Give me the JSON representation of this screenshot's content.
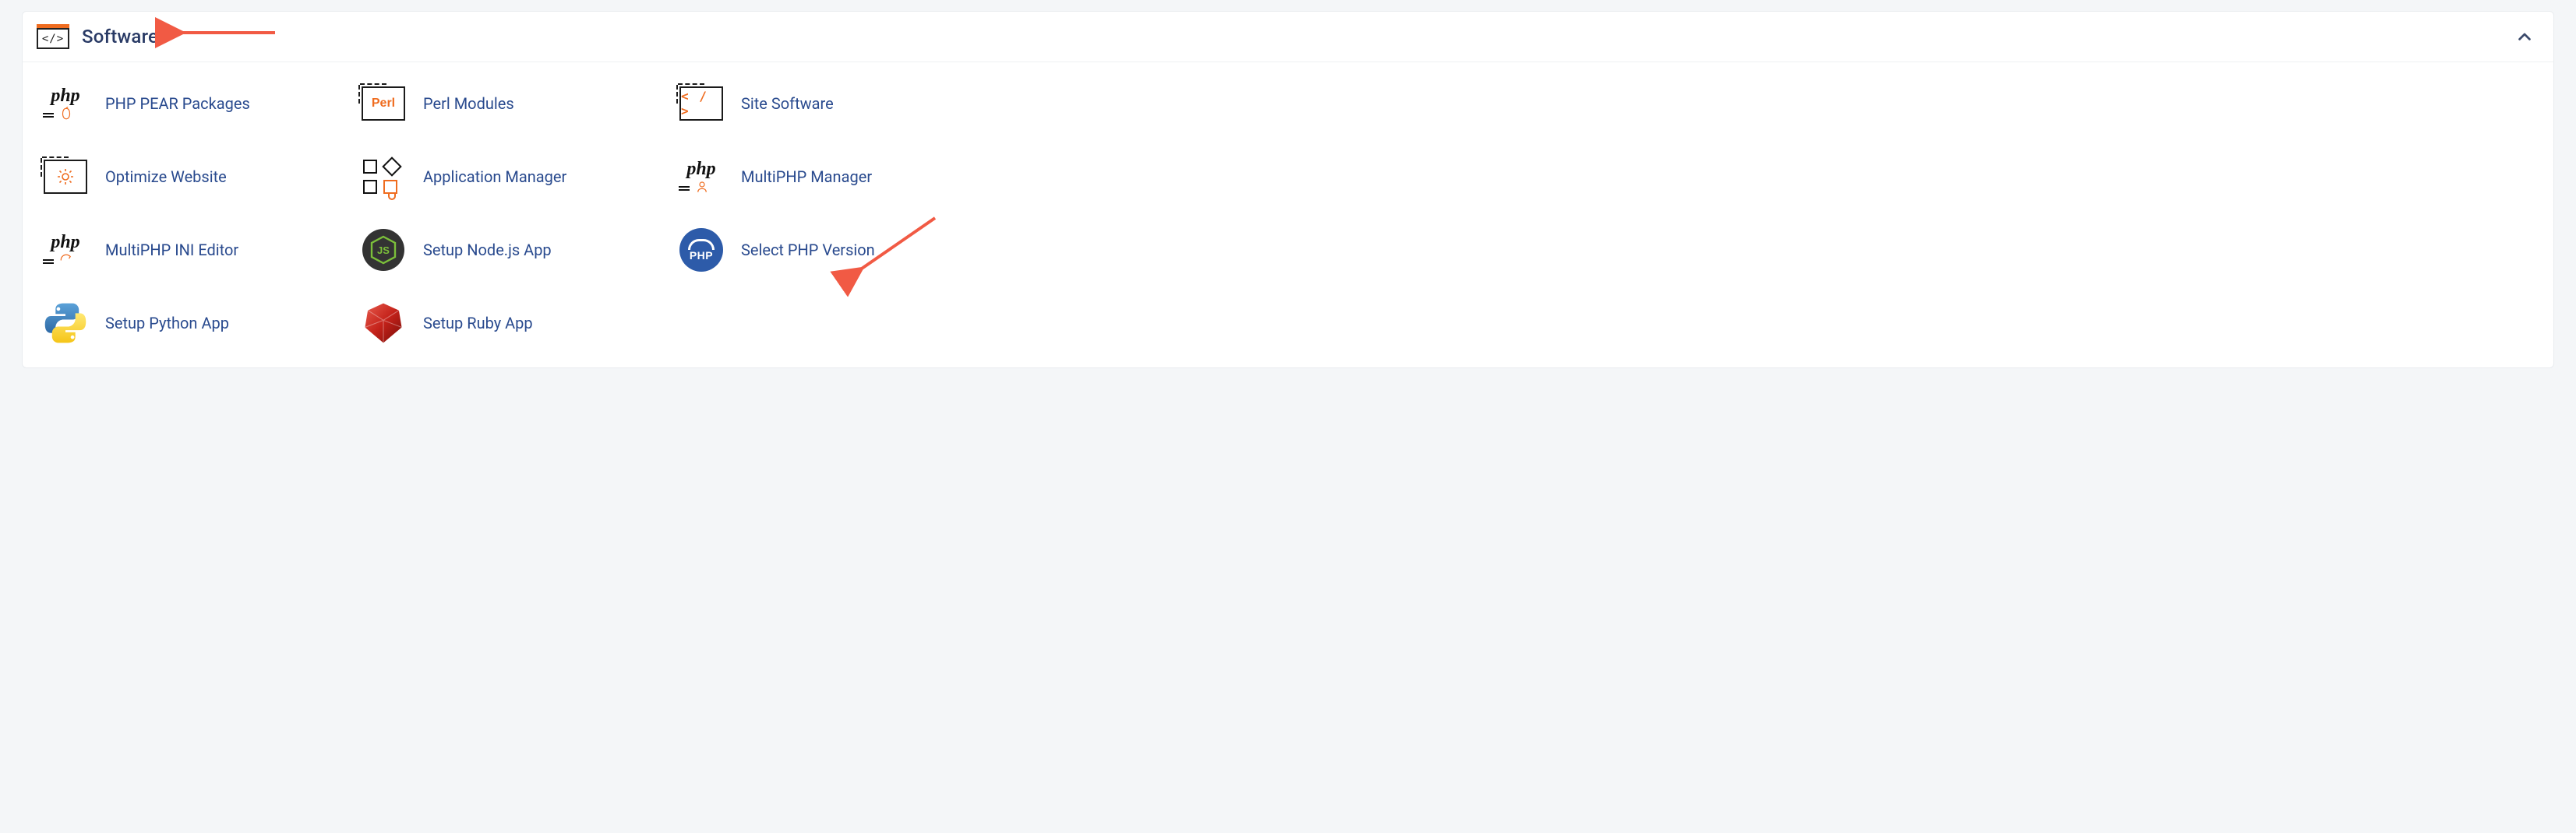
{
  "panel": {
    "title": "Software"
  },
  "items": [
    {
      "label": "PHP PEAR Packages"
    },
    {
      "label": "Perl Modules"
    },
    {
      "label": "Site Software"
    },
    {
      "label": "Optimize Website"
    },
    {
      "label": "Application Manager"
    },
    {
      "label": "MultiPHP Manager"
    },
    {
      "label": "MultiPHP INI Editor"
    },
    {
      "label": "Setup Node.js App"
    },
    {
      "label": "Select PHP Version"
    },
    {
      "label": "Setup Python App"
    },
    {
      "label": "Setup Ruby App"
    }
  ],
  "icon_text": {
    "perl": "Perl",
    "code": "< / >",
    "php": "php",
    "php_caps": "PHP",
    "header_code": "</>"
  }
}
